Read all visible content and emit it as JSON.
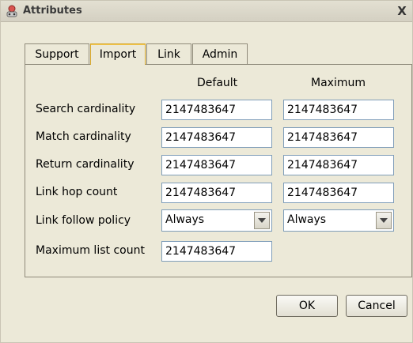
{
  "window": {
    "title": "Attributes",
    "close_glyph": "X"
  },
  "tabs": [
    {
      "label": "Support",
      "active": false
    },
    {
      "label": "Import",
      "active": true
    },
    {
      "label": "Link",
      "active": false
    },
    {
      "label": "Admin",
      "active": false
    }
  ],
  "columns": {
    "default": "Default",
    "maximum": "Maximum"
  },
  "rows": {
    "search_cardinality": {
      "label": "Search cardinality",
      "default": "2147483647",
      "maximum": "2147483647"
    },
    "match_cardinality": {
      "label": "Match cardinality",
      "default": "2147483647",
      "maximum": "2147483647"
    },
    "return_cardinality": {
      "label": "Return cardinality",
      "default": "2147483647",
      "maximum": "2147483647"
    },
    "link_hop_count": {
      "label": "Link hop count",
      "default": "2147483647",
      "maximum": "2147483647"
    },
    "link_follow_policy": {
      "label": "Link follow policy",
      "default": "Always",
      "maximum": "Always"
    },
    "maximum_list_count": {
      "label": "Maximum list count",
      "default": "2147483647"
    }
  },
  "buttons": {
    "ok": "OK",
    "cancel": "Cancel"
  },
  "colors": {
    "dialog_bg": "#ece9d8",
    "field_border": "#7f9db9",
    "active_tab_accent": "#f3c54a"
  },
  "icons": {
    "app": "attributes-app-icon",
    "close": "close-icon",
    "dropdown": "chevron-down-icon"
  }
}
